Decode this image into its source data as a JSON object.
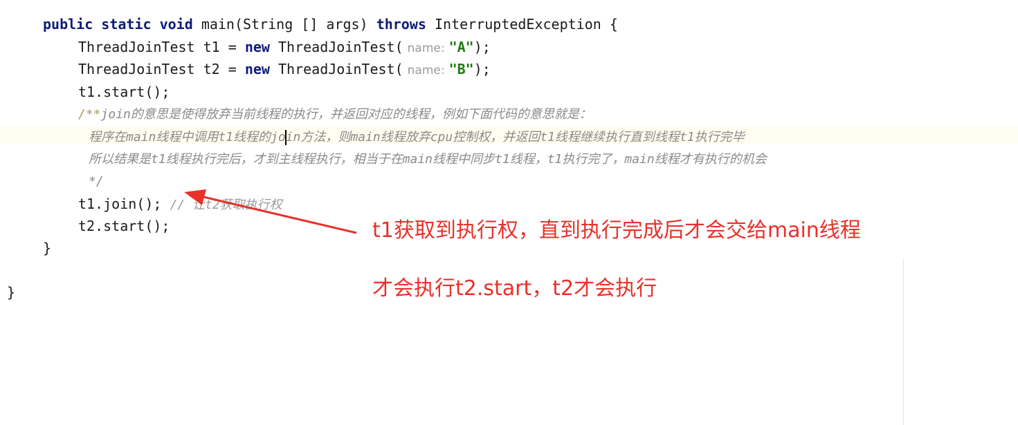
{
  "code": {
    "line1": {
      "kw1": "public",
      "kw2": "static",
      "kw3": "void",
      "text1": "main(String [] args)",
      "kw4": "throws",
      "text2": "InterruptedException {"
    },
    "line2": {
      "text1": "ThreadJoinTest t1 =",
      "kw": "new",
      "text2": "ThreadJoinTest(",
      "hint": "name:",
      "str": "\"A\"",
      "text3": ");"
    },
    "line3": {
      "text1": "ThreadJoinTest t2 =",
      "kw": "new",
      "text2": "ThreadJoinTest(",
      "hint": "name:",
      "str": "\"B\"",
      "text3": ");"
    },
    "line4": "t1.start();",
    "doc1_open": "/**",
    "doc1_text": "join的意思是使得放弃当前线程的执行，并返回对应的线程，例如下面代码的意思就是：",
    "doc2_before": "程序在main线程中调用t1线程的jo",
    "doc2_after": "in方法，则main线程放弃cpu控制权，并返回t1线程继续执行直到线程t1执行完毕",
    "doc3": "所以结果是t1线程执行完后，才到主线程执行，相当于在main线程中同步t1线程，t1执行完了，main线程才有执行的机会",
    "doc4": "*/",
    "line9_code": "t1.join();",
    "line9_comment": "// 让t2获取执行权",
    "line10": "t2.start();",
    "line11": "}",
    "line12": "}"
  },
  "annotation": {
    "line1": "t1获取到执行权，直到执行完成后才会交给main线程",
    "line2": "才会执行t2.start，t2才会执行",
    "color": "#e8312a"
  }
}
